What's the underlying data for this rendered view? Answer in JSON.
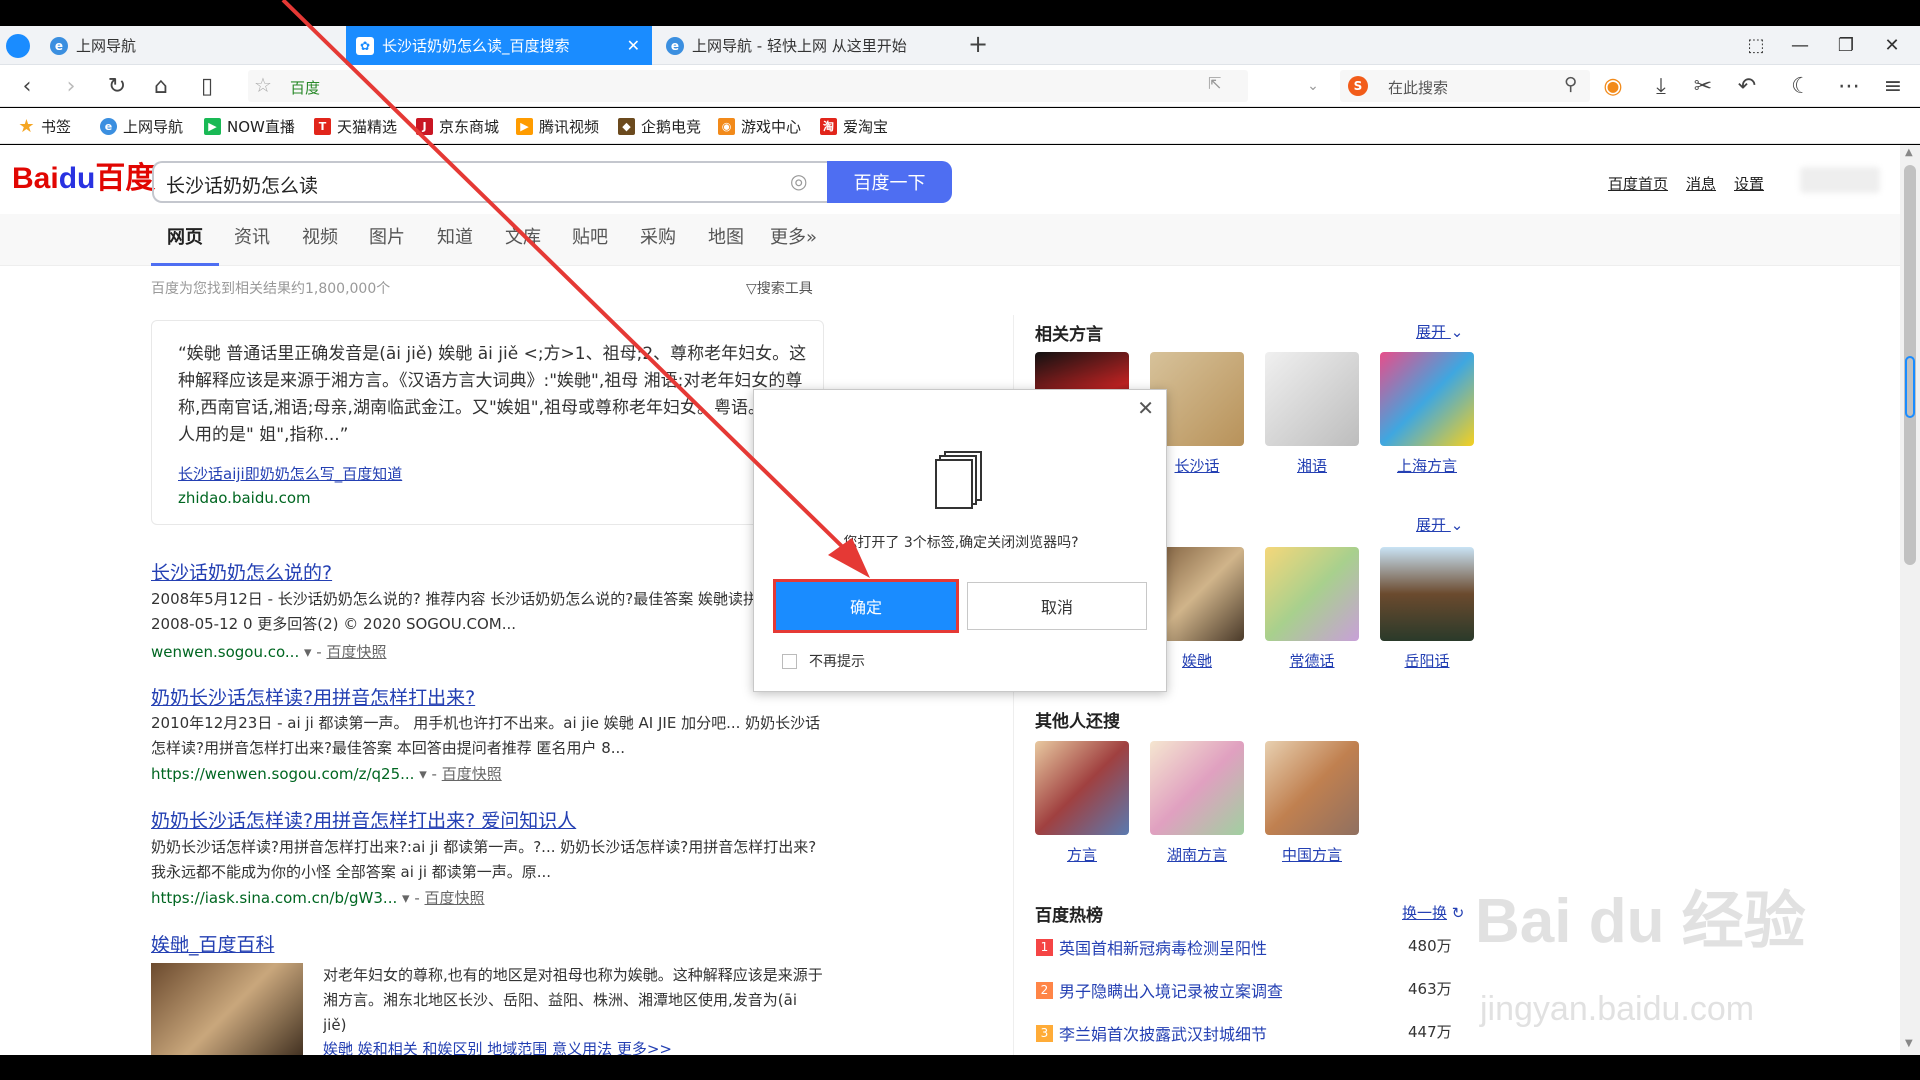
{
  "browser": {
    "tabs": [
      {
        "label": "上网导航"
      },
      {
        "label": "长沙话奶奶怎么读_百度搜索",
        "active": true
      },
      {
        "label": "上网导航 - 轻快上网 从这里开始"
      }
    ],
    "address_text": "百度",
    "search_placeholder": "在此搜索",
    "bookmarks": [
      "书签",
      "上网导航",
      "NOW直播",
      "天猫精选",
      "京东商城",
      "腾讯视频",
      "企鹅电竞",
      "游戏中心",
      "爱淘宝"
    ],
    "accent": "#1a8cff"
  },
  "baidu": {
    "query": "长沙话奶奶怎么读",
    "search_button": "百度一下",
    "top_links": [
      "百度首页",
      "消息",
      "设置"
    ],
    "vertical_tabs": [
      "网页",
      "资讯",
      "视频",
      "图片",
      "知道",
      "文库",
      "贴吧",
      "采购",
      "地图",
      "更多»"
    ],
    "result_count": "百度为您找到相关结果约1,800,000个",
    "search_tools": "搜索工具",
    "zhidao": {
      "text": "“娭毑 普通话里正确发音是(āi jiě) 娭毑 āi jiě <;方>1、祖母;2、尊称老年妇女。这种解释应该是来源于湘方言。《汉语方言大词典》:\"娭毑\",祖母 湘语;对老年妇女的尊称,西南官话,湘语;母亲,湖南临武金江。又\"娭姐\",祖母或尊称老年妇女。粤语。客家人用的是\" 姐\",指称...”",
      "link": "长沙话aiji即奶奶怎么写_百度知道",
      "url": "zhidao.baidu.com"
    },
    "results": [
      {
        "title": "长沙话奶奶怎么说的?",
        "text": "2008年5月12日 - 长沙话奶奶怎么说的? 推荐内容 长沙话奶奶怎么说的?最佳答案 娭毑读拼音就好2008-05-12 0 更多回答(2) © 2020 SOGOU.COM...",
        "url": "wenwen.sogou.co...",
        "snapshot": "百度快照"
      },
      {
        "title": "奶奶长沙话怎样读?用拼音怎样打出来?",
        "text": "2010年12月23日 - ai ji 都读第一声。 用手机也许打不出来。ai jie 娭毑 AI JIE 加分吧... 奶奶长沙话怎样读?用拼音怎样打出来?最佳答案 本回答由提问者推荐 匿名用户 8...",
        "url": "https://wenwen.sogou.com/z/q25...",
        "snapshot": "百度快照"
      },
      {
        "title": "奶奶长沙话怎样读?用拼音怎样打出来? 爱问知识人",
        "text": "奶奶长沙话怎样读?用拼音怎样打出来?:ai ji 都读第一声。?... 奶奶长沙话怎样读?用拼音怎样打出来?我永远都不能成为你的小怪 全部答案 ai ji 都读第一声。原...",
        "url": "https://iask.sina.com.cn/b/gW3...",
        "snapshot": "百度快照"
      },
      {
        "title": "娭毑_百度百科",
        "text": "对老年妇女的尊称,也有的地区是对祖母也称为娭毑。这种解释应该是来源于湘方言。湘东北地区长沙、岳阳、益阳、株洲、湘潭地区使用,发音为(āi jiě)",
        "sub": "娭毑 娭和相关 和娭区别 地域范围 意义用法 更多>>"
      }
    ],
    "right": {
      "related_dialects": {
        "heading": "相关方言",
        "more": "展开",
        "items": [
          "长沙话",
          "湘语",
          "上海方言"
        ]
      },
      "row2": {
        "more": "展开",
        "items": [
          "娭毑",
          "常德话",
          "岳阳话"
        ]
      },
      "others": {
        "heading": "其他人还搜",
        "items": [
          "方言",
          "湖南方言",
          "中国方言"
        ]
      },
      "hot": {
        "heading": "百度热榜",
        "refresh": "换一换",
        "items": [
          {
            "rank": "1",
            "title": "英国首相新冠病毒检测呈阳性",
            "count": "480万"
          },
          {
            "rank": "2",
            "title": "男子隐瞒出入境记录被立案调查",
            "count": "463万"
          },
          {
            "rank": "3",
            "title": "李兰娟首次披露武汉封城细节",
            "count": "447万"
          }
        ]
      }
    }
  },
  "dialog": {
    "message": "您打开了 3个标签,确定关闭浏览器吗?",
    "ok": "确定",
    "cancel": "取消",
    "checkbox": "不再提示"
  },
  "watermark": {
    "brand": "Bai du 经验",
    "url": "jingyan.baidu.com"
  }
}
